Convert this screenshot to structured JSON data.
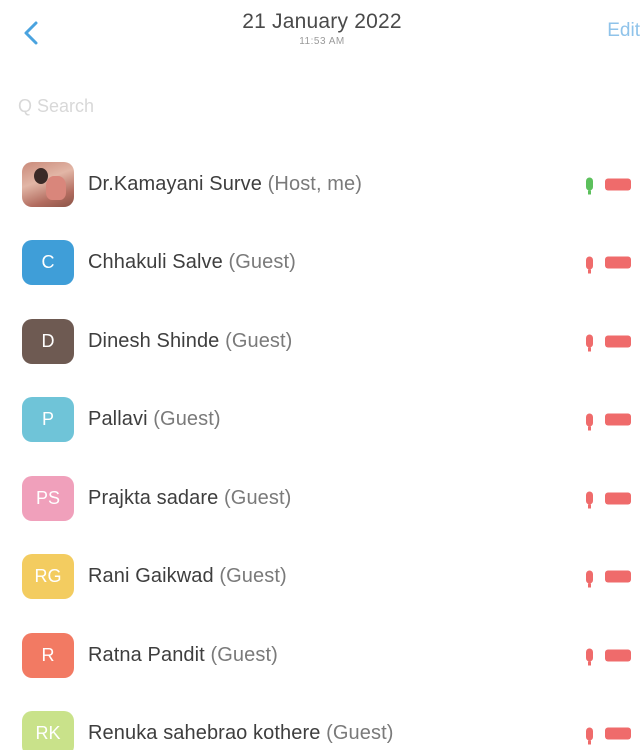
{
  "header": {
    "date": "21 January 2022",
    "time": "11:53 AM",
    "edit_label": "Edit",
    "back_icon": "chevron-left-icon"
  },
  "search": {
    "placeholder": "Q Search"
  },
  "colors": {
    "accent": "#4aa3df",
    "mic_on": "#5cc05c",
    "muted": "#ef6b6b"
  },
  "participants": [
    {
      "initials": "",
      "name": "Dr.Kamayani Surve",
      "role": "(Host, me)",
      "avatar_color": "#c98a7a",
      "mic": "on"
    },
    {
      "initials": "C",
      "name": "Chhakuli Salve",
      "role": "(Guest)",
      "avatar_color": "#3f9ed8",
      "mic": "muted"
    },
    {
      "initials": "D",
      "name": "Dinesh Shinde",
      "role": "(Guest)",
      "avatar_color": "#6e5a52",
      "mic": "muted"
    },
    {
      "initials": "P",
      "name": "Pallavi",
      "role": "(Guest)",
      "avatar_color": "#6fc4d8",
      "mic": "muted"
    },
    {
      "initials": "PS",
      "name": "Prajkta sadare",
      "role": "(Guest)",
      "avatar_color": "#f0a0bb",
      "mic": "muted"
    },
    {
      "initials": "RG",
      "name": "Rani Gaikwad",
      "role": "(Guest)",
      "avatar_color": "#f3cc60",
      "mic": "muted"
    },
    {
      "initials": "R",
      "name": "Ratna Pandit",
      "role": "(Guest)",
      "avatar_color": "#f27a63",
      "mic": "muted"
    },
    {
      "initials": "RK",
      "name": "Renuka sahebrao kothere",
      "role": "(Guest)",
      "avatar_color": "#c9e28a",
      "mic": "muted"
    }
  ]
}
